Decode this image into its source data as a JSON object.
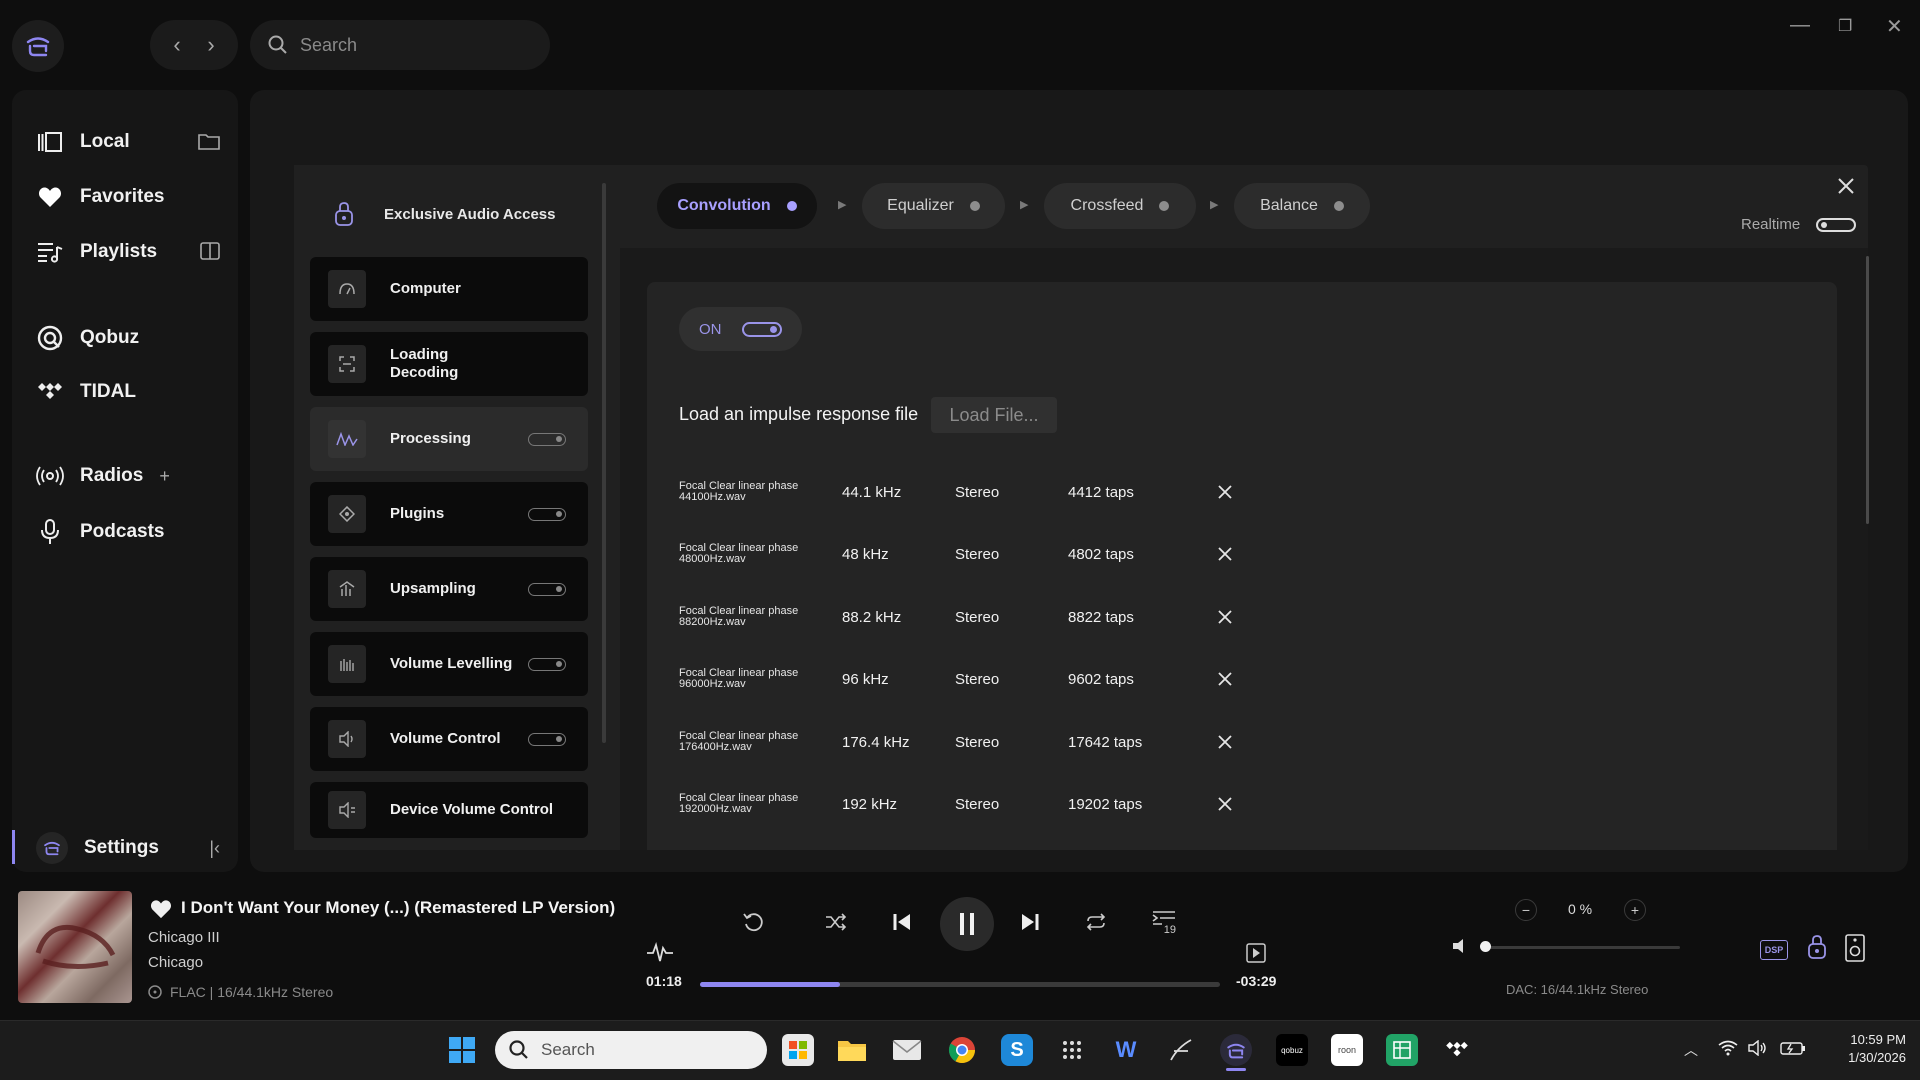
{
  "topbar": {
    "search_placeholder": "Search",
    "back_icon": "chevron-left-icon",
    "forward_icon": "chevron-right-icon"
  },
  "sidebar": {
    "items": [
      {
        "label": "Local",
        "icon": "library-icon"
      },
      {
        "label": "Favorites",
        "icon": "heart-icon"
      },
      {
        "label": "Playlists",
        "icon": "playlist-icon"
      },
      {
        "label": "Qobuz",
        "icon": "qobuz-icon"
      },
      {
        "label": "TIDAL",
        "icon": "tidal-icon"
      },
      {
        "label": "Radios",
        "icon": "radio-icon"
      },
      {
        "label": "Podcasts",
        "icon": "microphone-icon"
      }
    ],
    "settings_label": "Settings"
  },
  "dsp_nav": {
    "header": "Exclusive Audio Access",
    "items": [
      {
        "label": "Computer",
        "toggle": null
      },
      {
        "label": "Loading\nDecoding",
        "toggle": null
      },
      {
        "label": "Processing",
        "toggle": "off",
        "active": true
      },
      {
        "label": "Plugins",
        "toggle": "off"
      },
      {
        "label": "Upsampling",
        "toggle": "off"
      },
      {
        "label": "Volume Levelling",
        "toggle": "off"
      },
      {
        "label": "Volume Control",
        "toggle": "off"
      },
      {
        "label": "Device Volume Control",
        "toggle": null
      }
    ]
  },
  "chain": {
    "tabs": [
      "Convolution",
      "Equalizer",
      "Crossfeed",
      "Balance"
    ],
    "active": "Convolution",
    "realtime_label": "Realtime"
  },
  "convolution": {
    "on_label": "ON",
    "load_label": "Load an impulse response file",
    "load_button": "Load File...",
    "files": [
      {
        "name_line1": "Focal Clear linear phase",
        "name_line2": "44100Hz.wav",
        "rate": "44.1 kHz",
        "channels": "Stereo",
        "taps": "4412 taps"
      },
      {
        "name_line1": "Focal Clear linear phase",
        "name_line2": "48000Hz.wav",
        "rate": "48 kHz",
        "channels": "Stereo",
        "taps": "4802 taps"
      },
      {
        "name_line1": "Focal Clear linear phase",
        "name_line2": "88200Hz.wav",
        "rate": "88.2 kHz",
        "channels": "Stereo",
        "taps": "8822 taps"
      },
      {
        "name_line1": "Focal Clear linear phase",
        "name_line2": "96000Hz.wav",
        "rate": "96 kHz",
        "channels": "Stereo",
        "taps": "9602 taps"
      },
      {
        "name_line1": "Focal Clear linear phase",
        "name_line2": "176400Hz.wav",
        "rate": "176.4 kHz",
        "channels": "Stereo",
        "taps": "17642 taps"
      },
      {
        "name_line1": "Focal Clear linear phase",
        "name_line2": "192000Hz.wav",
        "rate": "192 kHz",
        "channels": "Stereo",
        "taps": "19202 taps"
      }
    ]
  },
  "player": {
    "title": "I Don't Want Your Money (...) (Remastered LP Version)",
    "album": "Chicago III",
    "artist": "Chicago",
    "format": "FLAC | 16/44.1kHz Stereo",
    "elapsed": "01:18",
    "remaining": "-03:29",
    "progress": 0.27,
    "volume_percent": "0 %",
    "volume_level": 0.0,
    "dac": "DAC: 16/44.1kHz Stereo",
    "dsp_badge": "DSP",
    "queue_count": "19"
  },
  "taskbar": {
    "search_placeholder": "Search",
    "time": "10:59 PM",
    "date": "1/30/2026",
    "qobuz_label": "qobuz",
    "roon_label": "roon"
  },
  "colors": {
    "accent": "#8e86f0",
    "background": "#0e0e0e",
    "panel": "#202020"
  }
}
